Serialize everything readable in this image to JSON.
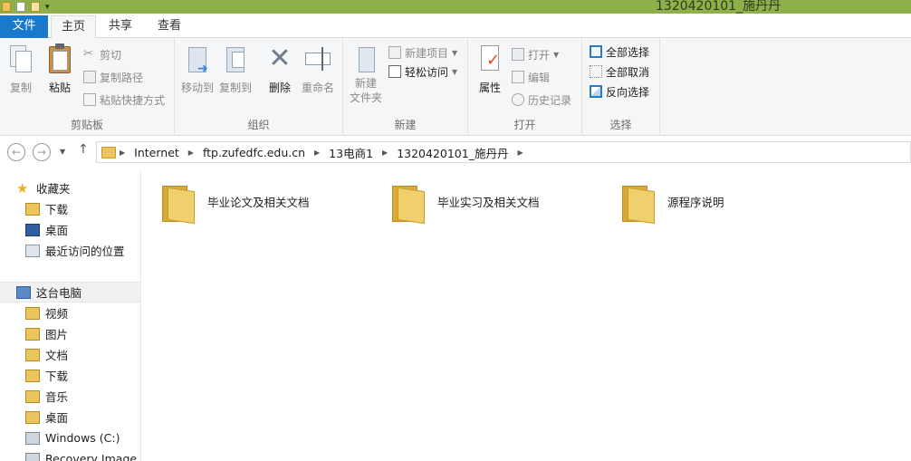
{
  "window": {
    "title": "1320420101_施丹丹"
  },
  "tabs": {
    "file": "文件",
    "home": "主页",
    "share": "共享",
    "view": "查看"
  },
  "ribbon": {
    "clipboard": {
      "label": "剪贴板",
      "copy": "复制",
      "paste": "粘贴",
      "cut": "剪切",
      "copy_path": "复制路径",
      "paste_shortcut": "粘贴快捷方式"
    },
    "organize": {
      "label": "组织",
      "move_to": "移动到",
      "copy_to": "复制到",
      "delete": "删除",
      "rename": "重命名"
    },
    "new": {
      "label": "新建",
      "new_folder": "新建\n文件夹",
      "new_item": "新建项目",
      "easy_access": "轻松访问"
    },
    "open": {
      "label": "打开",
      "properties": "属性",
      "open": "打开",
      "edit": "编辑",
      "history": "历史记录"
    },
    "select": {
      "label": "选择",
      "select_all": "全部选择",
      "select_none": "全部取消",
      "invert": "反向选择"
    }
  },
  "address": {
    "crumbs": [
      "Internet",
      "ftp.zufedfc.edu.cn",
      "13电商1",
      "1320420101_施丹丹"
    ]
  },
  "navpane": {
    "favorites": {
      "label": "收藏夹",
      "items": [
        "下载",
        "桌面",
        "最近访问的位置"
      ]
    },
    "thispc": {
      "label": "这台电脑",
      "items": [
        "视频",
        "图片",
        "文档",
        "下载",
        "音乐",
        "桌面",
        "Windows (C:)",
        "Recovery Image (D"
      ]
    }
  },
  "files": [
    {
      "name": "毕业论文及相关文档"
    },
    {
      "name": "毕业实习及相关文档"
    },
    {
      "name": "源程序说明"
    }
  ],
  "colors": {
    "accent": "#1979ca",
    "titlebar": "#8db04a",
    "folder": "#e9c45f"
  },
  "icons": [
    "folder-icon",
    "star-icon",
    "computer-icon",
    "desktop-icon",
    "download-icon",
    "drive-icon"
  ]
}
